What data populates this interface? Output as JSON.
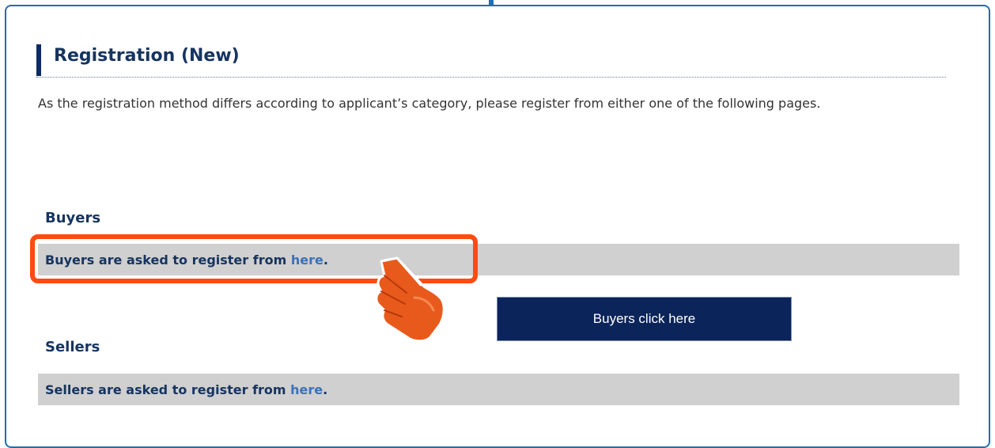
{
  "heading": {
    "title": "Registration (New)"
  },
  "intro": {
    "text": "As the registration method differs according to applicant’s category, please register from either one of the following pages."
  },
  "buyers": {
    "heading": "Buyers",
    "prompt": "Buyers are asked to register from ",
    "link_label": "here",
    "suffix": "."
  },
  "sellers": {
    "heading": "Sellers",
    "prompt": "Sellers are asked to register from ",
    "link_label": "here",
    "suffix": "."
  },
  "callout": {
    "label": "Buyers click here"
  },
  "icons": {
    "pointer": "pointing-hand-icon"
  },
  "colors": {
    "frame": "#1f6fb5",
    "heading": "#16345f",
    "link": "#3d70b7",
    "highlight": "#ff4a12",
    "callout_bg": "#0b2459",
    "row_bg": "#d0d0d0"
  }
}
